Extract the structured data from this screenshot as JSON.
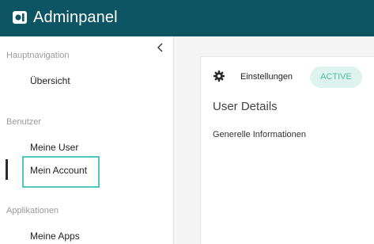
{
  "header": {
    "app_title": "Adminpanel",
    "logo_icon": "admin-logo-icon",
    "background": "#0e5563"
  },
  "sidebar": {
    "collapse_icon": "chevron-left-icon",
    "sections": [
      {
        "label": "Hauptnavigation",
        "items": [
          {
            "label": "Übersicht"
          }
        ]
      },
      {
        "label": "Benutzer",
        "items": [
          {
            "label": "Meine User"
          },
          {
            "label": "Mein Account",
            "active": true
          }
        ]
      },
      {
        "label": "Applikationen",
        "items": [
          {
            "label": "Meine Apps"
          }
        ]
      }
    ],
    "accent_color": "#4fc7c0"
  },
  "content": {
    "settings_icon": "gear-icon",
    "settings_label": "Einstellungen",
    "status_badge": "ACTIVE",
    "status_color": "#4cbfa6",
    "section_title": "User Details",
    "subsection_label": "Generelle Informationen"
  }
}
